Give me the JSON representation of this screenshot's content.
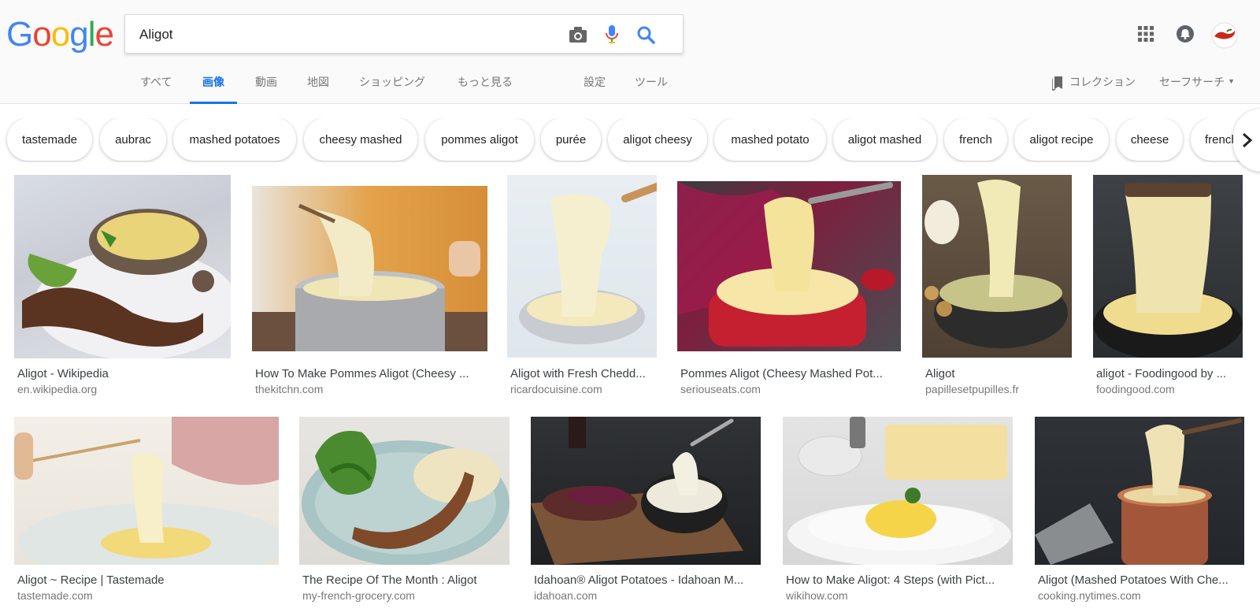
{
  "search": {
    "query": "Aligot"
  },
  "logo": {
    "letters": [
      "G",
      "o",
      "o",
      "g",
      "l",
      "e"
    ],
    "colors": [
      "#4285F4",
      "#EA4335",
      "#FBBC05",
      "#4285F4",
      "#34A853",
      "#EA4335"
    ]
  },
  "icons": {
    "camera": "camera-icon",
    "mic": "mic-icon",
    "search": "search-icon",
    "apps": "apps-grid-icon",
    "notifications": "bell-icon",
    "avatar": "avatar"
  },
  "tabs": [
    "すべて",
    "画像",
    "動画",
    "地図",
    "ショッピング",
    "もっと見る",
    "設定",
    "ツール"
  ],
  "header_right": {
    "collections": "コレクション",
    "safesearch": "セーフサーチ"
  },
  "accent_color": "#1a73e8",
  "chips": [
    "tastemade",
    "aubrac",
    "mashed potatoes",
    "cheesy mashed",
    "pommes aligot",
    "purée",
    "aligot cheesy",
    "mashed potato",
    "aligot mashed",
    "french",
    "aligot recipe",
    "cheese",
    "french"
  ],
  "results": [
    {
      "title": "Aligot - Wikipedia",
      "site": "en.wikipedia.org"
    },
    {
      "title": "How To Make Pommes Aligot (Cheesy ...",
      "site": "thekitchn.com"
    },
    {
      "title": "Aligot with Fresh Chedd...",
      "site": "ricardocuisine.com"
    },
    {
      "title": "Pommes Aligot (Cheesy Mashed Pot...",
      "site": "seriouseats.com"
    },
    {
      "title": "Aligot",
      "site": "papillesetpupilles.fr"
    },
    {
      "title": "aligot - Foodingood by ...",
      "site": "foodingood.com"
    },
    {
      "title": "Aligot ~ Recipe | Tastemade",
      "site": "tastemade.com"
    },
    {
      "title": "The Recipe Of The Month : Aligot",
      "site": "my-french-grocery.com"
    },
    {
      "title": "Idahoan® Aligot Potatoes - Idahoan M...",
      "site": "idahoan.com"
    },
    {
      "title": "How to Make Aligot: 4 Steps (with Pict...",
      "site": "wikihow.com"
    },
    {
      "title": "Aligot (Mashed Potatoes With Che...",
      "site": "cooking.nytimes.com"
    }
  ]
}
